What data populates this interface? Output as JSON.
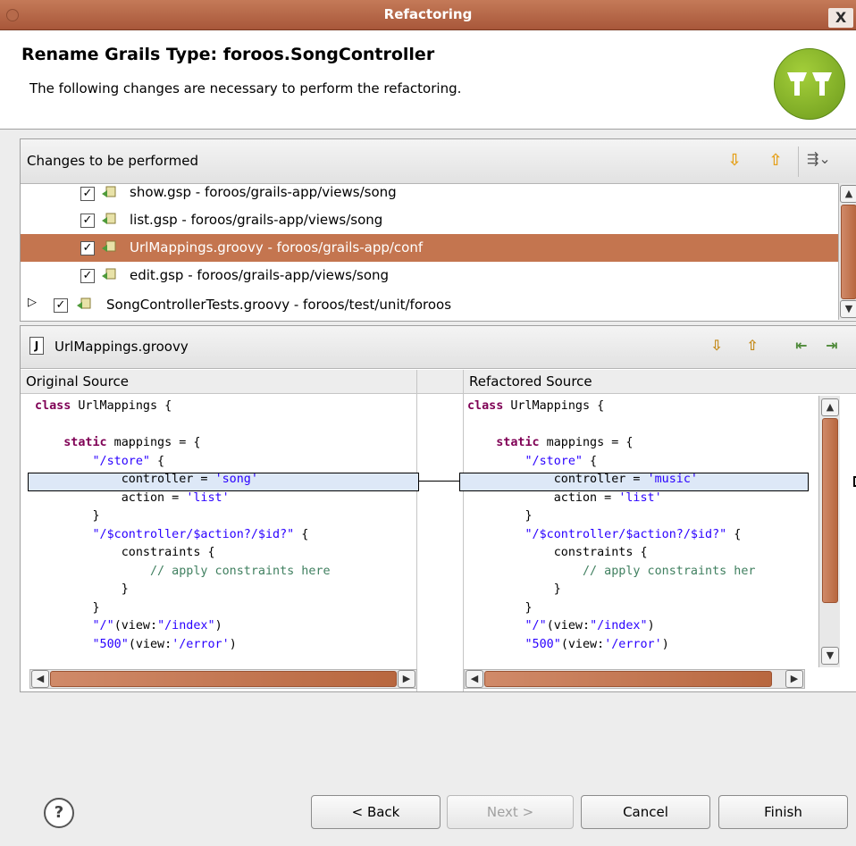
{
  "window": {
    "title": "Refactoring",
    "close_glyph": "X"
  },
  "header": {
    "title": "Rename Grails Type: foroos.SongController",
    "description": "The following changes are necessary to perform the refactoring.",
    "logo_icon": "grails-logo-icon"
  },
  "changes": {
    "label": "Changes to be performed",
    "toolbar_icons": [
      "next-change-icon",
      "previous-change-icon",
      "filter-changes-icon"
    ],
    "rows": [
      {
        "label": "show.gsp - foroos/grails-app/views/song",
        "checked": true,
        "selected": false
      },
      {
        "label": "list.gsp - foroos/grails-app/views/song",
        "checked": true,
        "selected": false
      },
      {
        "label": "UrlMappings.groovy - foroos/grails-app/conf",
        "checked": true,
        "selected": true
      },
      {
        "label": "edit.gsp - foroos/grails-app/views/song",
        "checked": true,
        "selected": false
      },
      {
        "label": "SongControllerTests.groovy - foroos/test/unit/foroos",
        "checked": true,
        "selected": false,
        "expandable": true
      }
    ]
  },
  "compare": {
    "file": "UrlMappings.groovy",
    "toolbar_icons": [
      "next-difference-icon",
      "previous-difference-icon",
      "copy-left-icon",
      "copy-right-icon"
    ],
    "left_header": "Original Source",
    "right_header": "Refactored Source",
    "left_code": {
      "line1_kw": "class",
      "line1_rest": " UrlMappings {",
      "line3_kw": "static",
      "line3_rest": " mappings = {",
      "line4": "\"/store\"",
      "line4_rest": " {",
      "line5_pre": "controller = ",
      "line5_str": "'song'",
      "line6_pre": "action = ",
      "line6_str": "'list'",
      "line7": "}",
      "line8": "\"/$controller/$action?/$id?\"",
      "line8_rest": " {",
      "line9": "constraints {",
      "line10": "// apply constraints here",
      "line11": "}",
      "line12": "}",
      "line13_str": "\"/\"",
      "line13_mid": "(view:",
      "line13_str2": "\"/index\"",
      "line13_end": ")",
      "line14_str": "\"500\"",
      "line14_mid": "(view:",
      "line14_str2": "'/error'",
      "line14_end": ")"
    },
    "right_code": {
      "line5_str": "'music'",
      "line10": "// apply constraints her"
    }
  },
  "footer": {
    "help_glyph": "?",
    "back": "< Back",
    "next": "Next >",
    "cancel": "Cancel",
    "finish": "Finish"
  },
  "colors": {
    "accent": "#c4754f",
    "keyword": "#7f0055",
    "string": "#2a00ff",
    "comment": "#3f7f5f"
  }
}
